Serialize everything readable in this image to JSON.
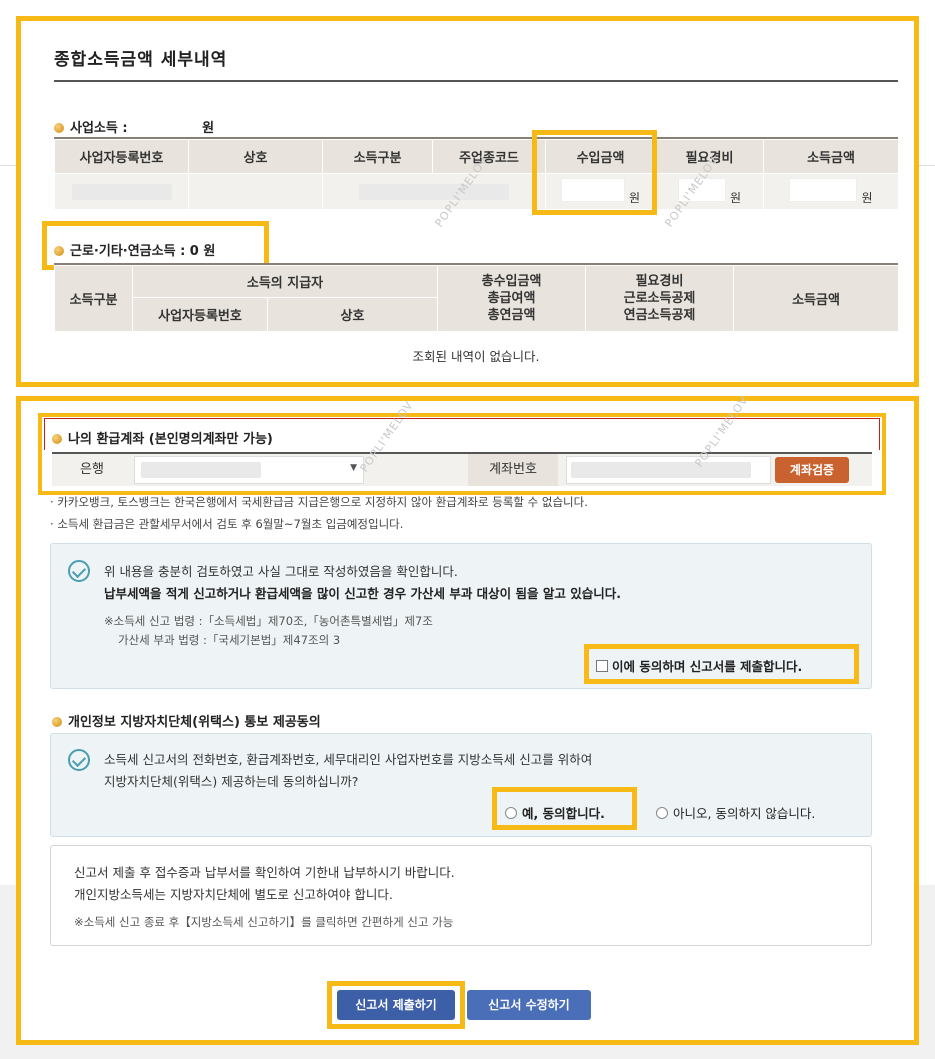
{
  "section1": {
    "title": "종합소득금액 세부내역",
    "business_label": "사업소득 :",
    "business_won": "원",
    "business_headers": [
      "사업자등록번호",
      "상호",
      "소득구분",
      "주업종코드",
      "수입금액",
      "필요경비",
      "소득금액"
    ],
    "won": "원",
    "labor_label": "근로·기타·연금소득 : 0 원",
    "labor_h_type": "소득구분",
    "labor_h_payer": "소득의 지급자",
    "labor_h_regno": "사업자등록번호",
    "labor_h_name": "상호",
    "labor_h_total1": "총수입금액",
    "labor_h_total2": "총급여액",
    "labor_h_total3": "총연금액",
    "labor_h_exp1": "필요경비",
    "labor_h_exp2": "근로소득공제",
    "labor_h_exp3": "연금소득공제",
    "labor_h_income": "소득금액",
    "empty_msg": "조회된 내역이 없습니다."
  },
  "refund": {
    "title": "나의 환급계좌 (본인명의계좌만 가능)",
    "bank_label": "은행",
    "account_label": "계좌번호",
    "verify_button": "계좌검증",
    "note1": "카카오뱅크, 토스뱅크는 한국은행에서 국세환급금 지급은행으로 지정하지 않아 환급계좌로 등록할 수 없습니다.",
    "note2": "소득세 환급금은 관할세무서에서 검토 후 6월말~7월초 입금예정입니다."
  },
  "confirm": {
    "line1": "위 내용을 충분히 검토하였고 사실 그대로 작성하였음을 확인합니다.",
    "line2": "납부세액을 적게 신고하거나 환급세액을 많이 신고한 경우 가산세 부과 대상이 됨을 알고 있습니다.",
    "law1": "※소득세 신고 법령 :「소득세법」제70조,「농어촌특별세법」제7조",
    "law2": "가산세 부과 법령 :「국세기본법」제47조의 3",
    "agree_checkbox": "이에 동의하며 신고서를 제출합니다."
  },
  "privacy": {
    "title": "개인정보 지방자치단체(위택스) 통보 제공동의",
    "line1": "소득세 신고서의 전화번호, 환급계좌번호, 세무대리인 사업자번호를 지방소득세 신고를 위하여",
    "line2": "지방자치단체(위택스) 제공하는데 동의하십니까?",
    "yes": "예, 동의합니다.",
    "no": "아니오, 동의하지 않습니다."
  },
  "info": {
    "line1": "신고서 제출 후 접수증과 납부서를 확인하여 기한내 납부하시기 바랍니다.",
    "line2": "개인지방소득세는 지방자치단체에 별도로 신고하여야 합니다.",
    "line3": "※소득세 신고 종료 후【지방소득세 신고하기】를 클릭하면 간편하게 신고 가능"
  },
  "buttons": {
    "submit": "신고서 제출하기",
    "edit": "신고서 수정하기"
  },
  "watermark": "POPLI'MELOV",
  "colors": {
    "highlight": "#f7b916",
    "submit_btn": "#3d5fa8",
    "verify_btn": "#c9622e"
  }
}
